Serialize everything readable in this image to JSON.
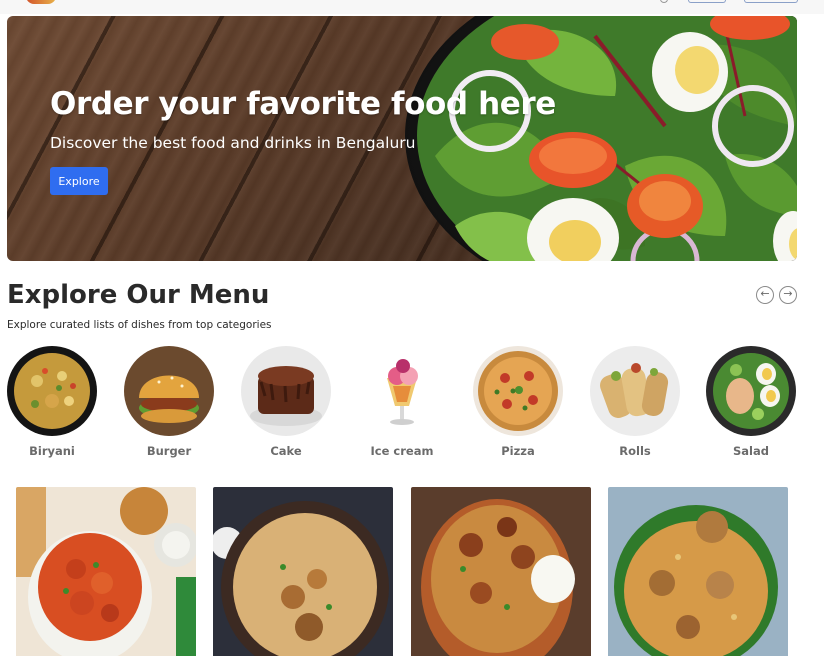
{
  "hero": {
    "title": "Order your favorite food here",
    "subtitle": "Discover the best food and drinks in Bengaluru",
    "cta_label": "Explore"
  },
  "explore": {
    "title": "Explore Our Menu",
    "subtitle": "Explore curated lists of dishes from top categories",
    "prev_icon": "arrow-left-circle-icon",
    "next_icon": "arrow-right-circle-icon"
  },
  "categories": [
    {
      "label": "Biryani"
    },
    {
      "label": "Burger"
    },
    {
      "label": "Cake"
    },
    {
      "label": "Ice cream"
    },
    {
      "label": "Pizza"
    },
    {
      "label": "Rolls"
    },
    {
      "label": "Salad"
    }
  ],
  "colors": {
    "accent": "#2f6df0",
    "category_label": "#6b6b6b",
    "heading": "#2a2a2a"
  }
}
